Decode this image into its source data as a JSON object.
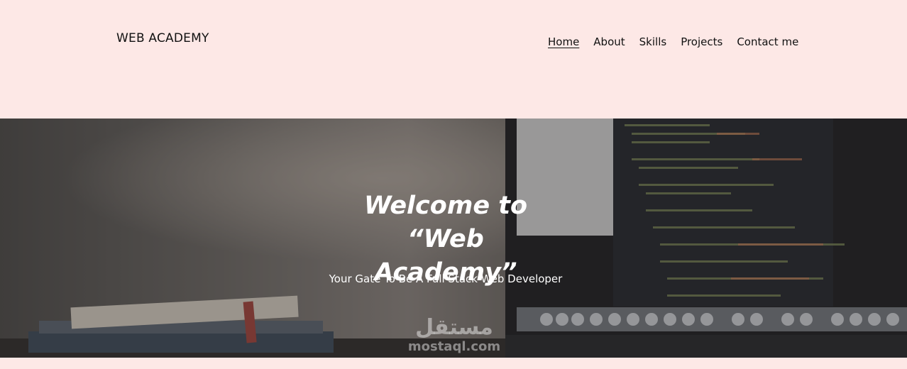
{
  "brand": {
    "name": "WEB ACADEMY"
  },
  "nav": {
    "items": [
      {
        "label": "Home",
        "active": true
      },
      {
        "label": "About",
        "active": false
      },
      {
        "label": "Skills",
        "active": false
      },
      {
        "label": "Projects",
        "active": false
      },
      {
        "label": "Contact me",
        "active": false
      }
    ]
  },
  "hero": {
    "title": "Welcome to “Web Academy”",
    "subtitle": "Your Gate To Be A Full Stack Web Developer",
    "background_icon": "laptop-code-books-photo"
  },
  "watermark": {
    "arabic": "مستقل",
    "latin": "mostaql.com"
  },
  "colors": {
    "header_bg": "#fde8e6",
    "text": "#111111",
    "hero_text": "#ffffff"
  }
}
